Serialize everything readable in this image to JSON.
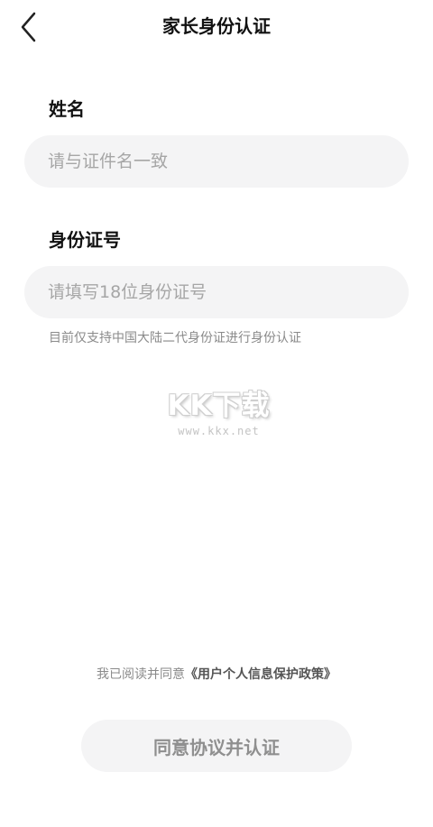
{
  "header": {
    "back_icon": "chevron-left-icon",
    "title": "家长身份认证"
  },
  "form": {
    "name": {
      "label": "姓名",
      "placeholder": "请与证件名一致",
      "value": ""
    },
    "id_number": {
      "label": "身份证号",
      "placeholder": "请填写18位身份证号",
      "value": ""
    },
    "hint": "目前仅支持中国大陆二代身份证进行身份认证"
  },
  "watermark": {
    "logo": "KK下载",
    "url": "www.kkx.net"
  },
  "agreement": {
    "prefix": "我已阅读并同意",
    "policy_link": "《用户个人信息保护政策》"
  },
  "submit": {
    "label": "同意协议并认证"
  },
  "colors": {
    "background": "#ffffff",
    "input_background": "#f4f4f5",
    "placeholder": "#a6a6a6",
    "hint_text": "#8a8a8a",
    "button_text_disabled": "#8f8f8f"
  }
}
